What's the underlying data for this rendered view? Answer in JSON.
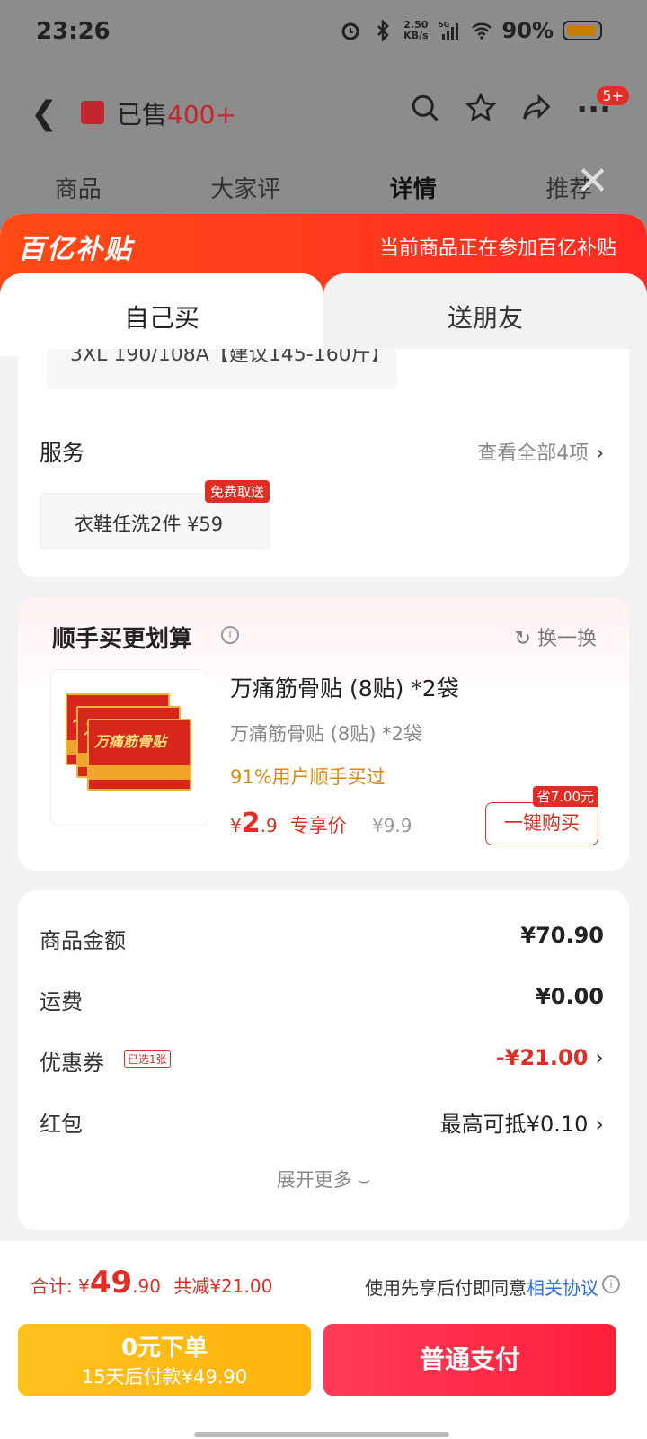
{
  "status_bar": {
    "time": "23:26",
    "net_speed_top": "2.50",
    "net_speed_bottom": "KB/s",
    "network": "5G",
    "battery": "90%"
  },
  "header": {
    "sold_label": "已售",
    "sold_count": "400+",
    "badge": "5+"
  },
  "bg_tabs": [
    "商品",
    "大家评",
    "详情",
    "推荐"
  ],
  "subsidy": {
    "logo": "百亿补贴",
    "text": "当前商品正在参加百亿补贴"
  },
  "buy_tabs": {
    "self": "自己买",
    "gift": "送朋友"
  },
  "size_chip_text": "3XL 190/108A【建议145-160斤】",
  "service": {
    "title": "服务",
    "more": "查看全部4项",
    "chip": "衣鞋任洗2件  ¥59",
    "tag": "免费取送"
  },
  "addon": {
    "title": "顺手买更划算",
    "swap": "换一换",
    "product_name": "万痛筋骨贴 (8贴) *2袋",
    "product_sub": "万痛筋骨贴 (8贴) *2袋",
    "product_pct": "91%用户顺手买过",
    "price_symbol": "¥",
    "price_int": "2",
    "price_dec": ".9",
    "price_tag": "专享价",
    "orig_price": "¥9.9",
    "save_tag": "省7.00元",
    "buy_button": "一键购买",
    "pkg_text": "万痛筋骨贴"
  },
  "summary": {
    "rows": [
      {
        "label": "商品金额",
        "value": "¥70.90"
      },
      {
        "label": "运费",
        "value": "¥0.00"
      },
      {
        "label": "优惠券",
        "value": "-¥21.00",
        "tag": "已选1张"
      },
      {
        "label": "红包",
        "value": "最高可抵¥0.10"
      }
    ],
    "expand": "展开更多"
  },
  "bottom": {
    "total_label": "合计: ¥",
    "total_int": "49",
    "total_dec": ".90",
    "reduced": "共减¥21.00",
    "agree_text": "使用先享后付即同意",
    "agree_link": "相关协议",
    "later_line1": "0元下单",
    "later_line2": "15天后付款¥49.90",
    "pay_button": "普通支付"
  }
}
